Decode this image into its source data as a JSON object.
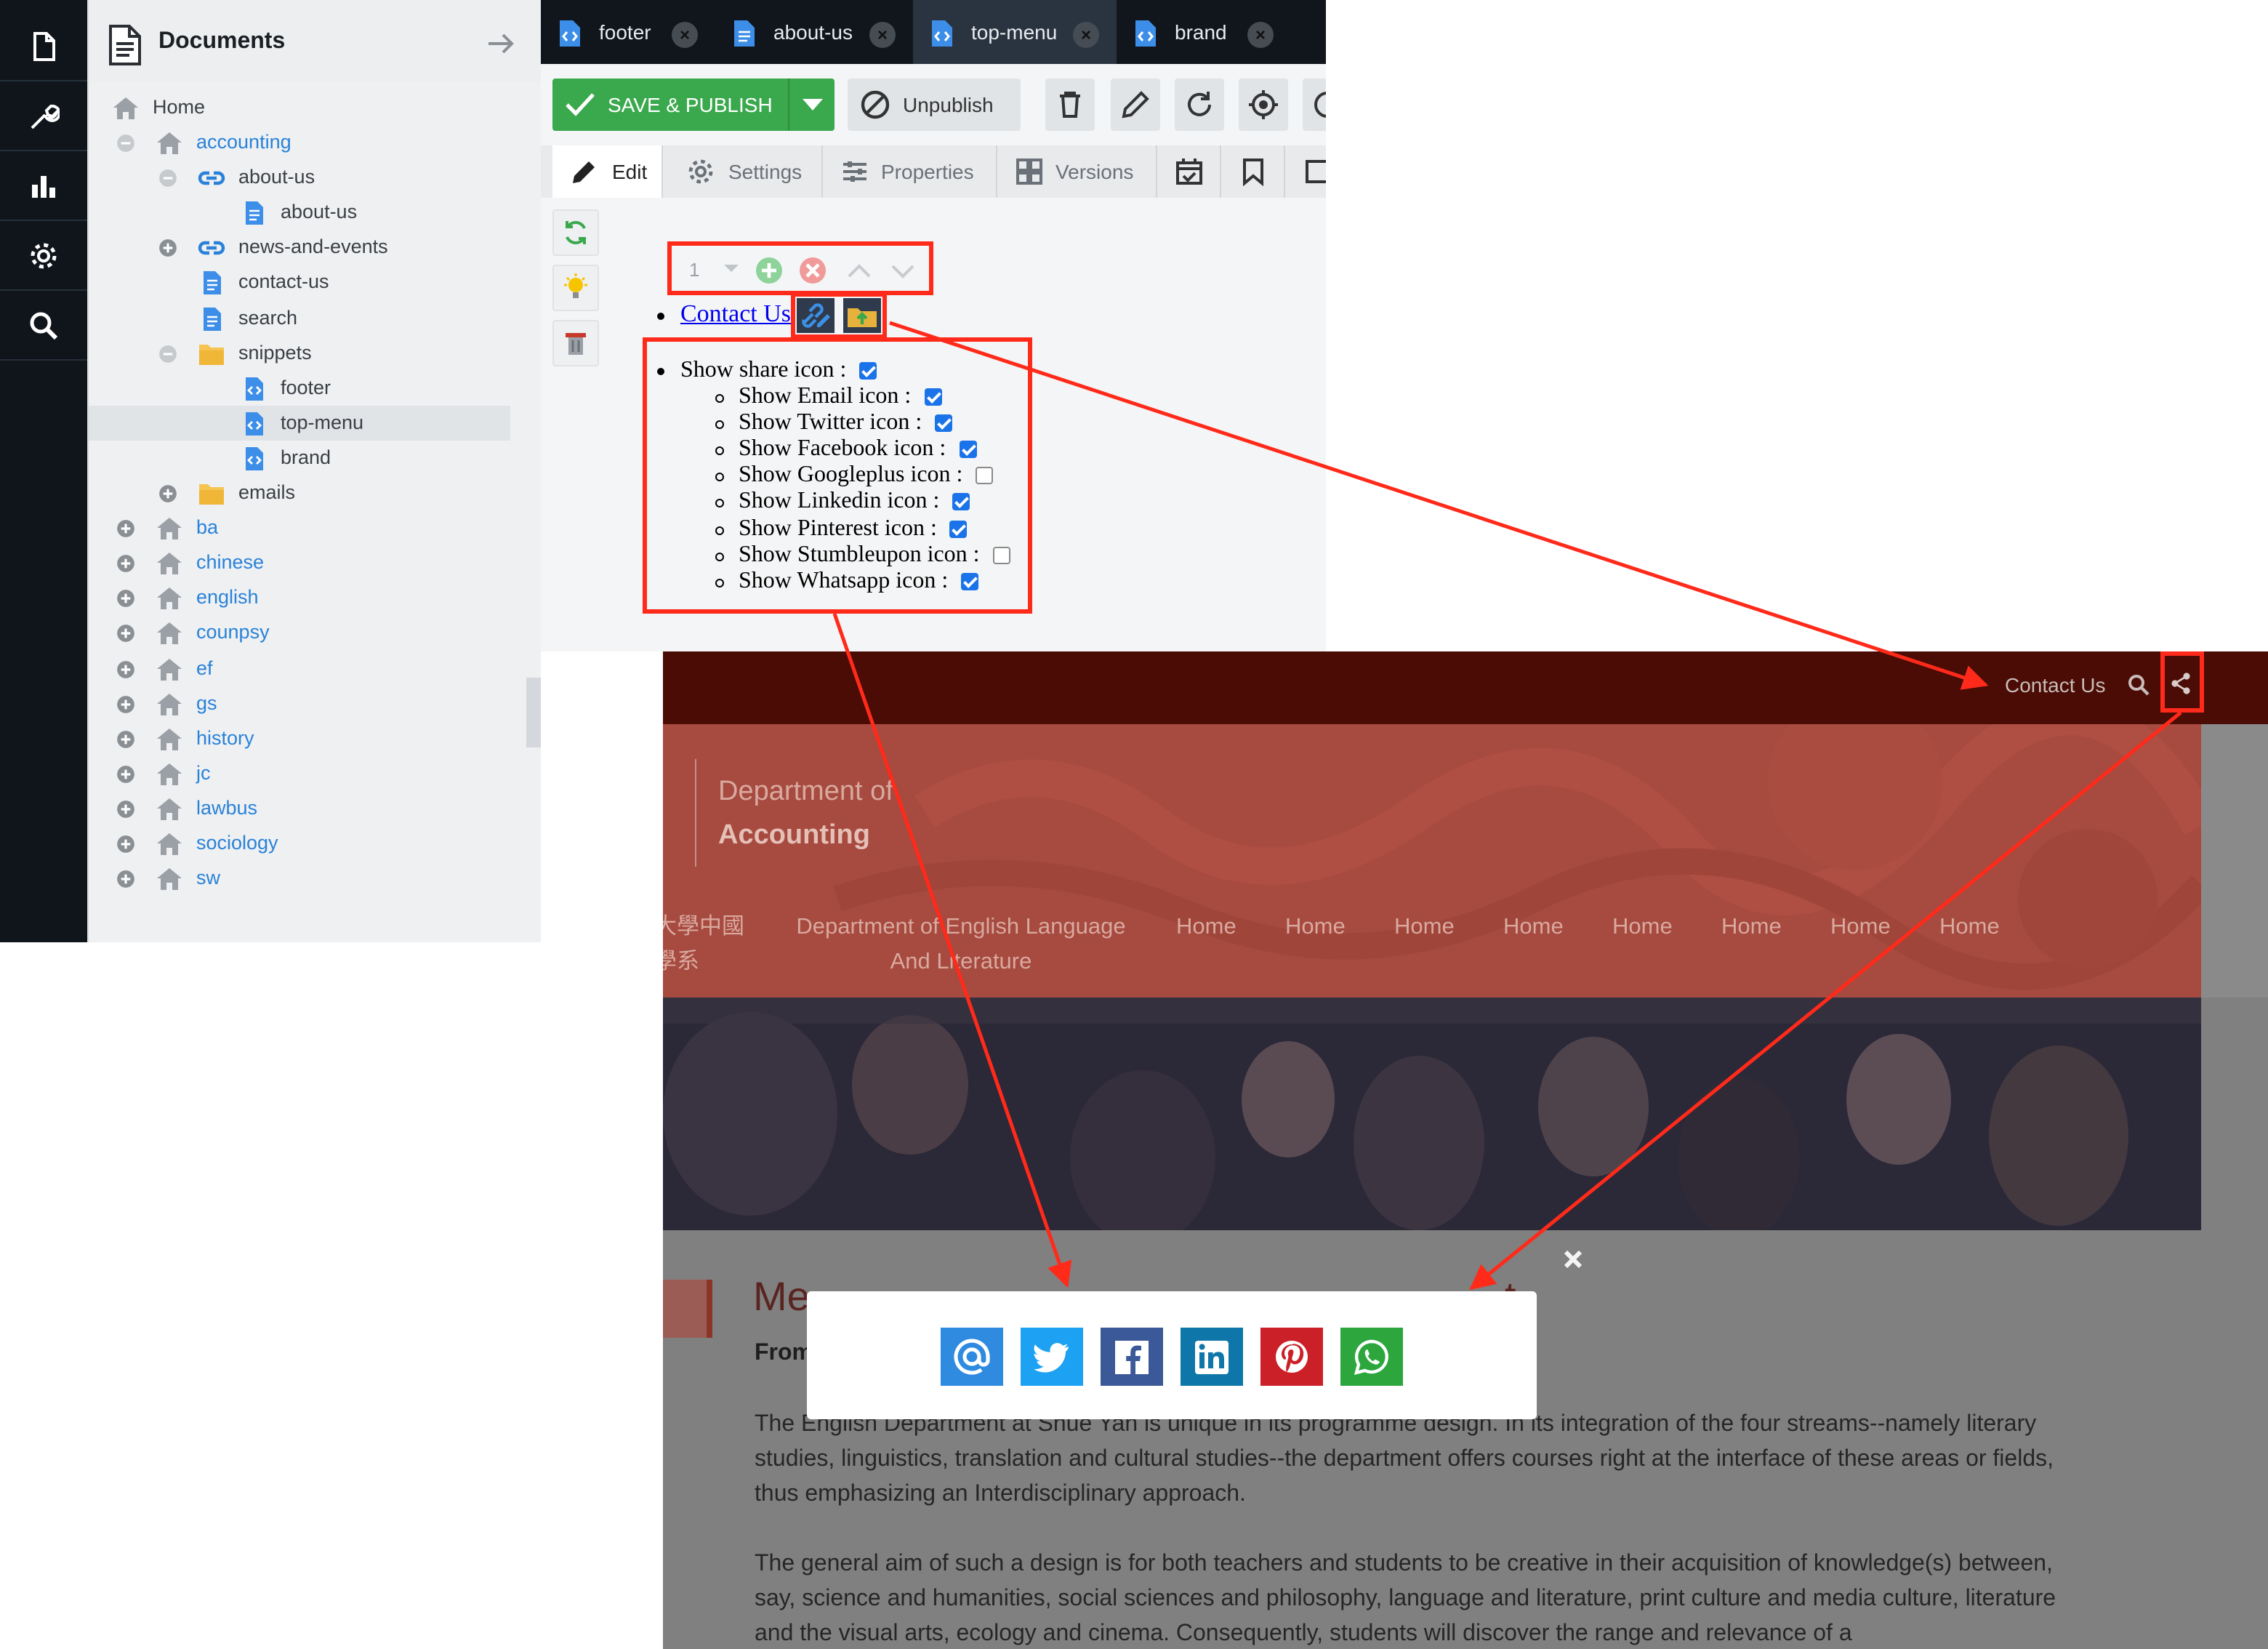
{
  "cms": {
    "documents_panel": {
      "title": "Documents",
      "tree": [
        {
          "label": "Home",
          "depth": 0,
          "toggle": "none",
          "icon": "home-icon",
          "linked": false
        },
        {
          "label": "accounting",
          "depth": 0,
          "toggle": "minus",
          "icon": "home-icon",
          "linked": true
        },
        {
          "label": "about-us",
          "depth": 1,
          "toggle": "minus",
          "icon": "link-icon",
          "linked": false
        },
        {
          "label": "about-us",
          "depth": 2,
          "toggle": "none",
          "icon": "page-icon",
          "linked": false
        },
        {
          "label": "news-and-events",
          "depth": 1,
          "toggle": "plus",
          "icon": "link-icon",
          "linked": false
        },
        {
          "label": "contact-us",
          "depth": 1,
          "toggle": "none",
          "icon": "page-icon",
          "linked": false
        },
        {
          "label": "search",
          "depth": 1,
          "toggle": "none",
          "icon": "page-icon",
          "linked": false
        },
        {
          "label": "snippets",
          "depth": 1,
          "toggle": "minus",
          "icon": "folder-icon",
          "linked": false
        },
        {
          "label": "footer",
          "depth": 2,
          "toggle": "none",
          "icon": "snippet-icon",
          "linked": false
        },
        {
          "label": "top-menu",
          "depth": 2,
          "toggle": "none",
          "icon": "snippet-icon",
          "linked": false,
          "selected": true
        },
        {
          "label": "brand",
          "depth": 2,
          "toggle": "none",
          "icon": "snippet-icon",
          "linked": false
        },
        {
          "label": "emails",
          "depth": 1,
          "toggle": "plus",
          "icon": "folder-icon",
          "linked": false
        },
        {
          "label": "ba",
          "depth": 0,
          "toggle": "plus",
          "icon": "home-icon",
          "linked": true
        },
        {
          "label": "chinese",
          "depth": 0,
          "toggle": "plus",
          "icon": "home-icon",
          "linked": true
        },
        {
          "label": "english",
          "depth": 0,
          "toggle": "plus",
          "icon": "home-icon",
          "linked": true
        },
        {
          "label": "counpsy",
          "depth": 0,
          "toggle": "plus",
          "icon": "home-icon",
          "linked": true
        },
        {
          "label": "ef",
          "depth": 0,
          "toggle": "plus",
          "icon": "home-icon",
          "linked": true
        },
        {
          "label": "gs",
          "depth": 0,
          "toggle": "plus",
          "icon": "home-icon",
          "linked": true
        },
        {
          "label": "history",
          "depth": 0,
          "toggle": "plus",
          "icon": "home-icon",
          "linked": true
        },
        {
          "label": "jc",
          "depth": 0,
          "toggle": "plus",
          "icon": "home-icon",
          "linked": true
        },
        {
          "label": "lawbus",
          "depth": 0,
          "toggle": "plus",
          "icon": "home-icon",
          "linked": true
        },
        {
          "label": "sociology",
          "depth": 0,
          "toggle": "plus",
          "icon": "home-icon",
          "linked": true
        },
        {
          "label": "sw",
          "depth": 0,
          "toggle": "plus",
          "icon": "home-icon",
          "linked": true
        }
      ]
    },
    "tabs": [
      {
        "label": "footer",
        "active": false
      },
      {
        "label": "about-us",
        "active": false
      },
      {
        "label": "top-menu",
        "active": true
      },
      {
        "label": "brand",
        "active": false
      }
    ],
    "toolbar": {
      "save_label": "SAVE & PUBLISH",
      "unpublish_label": "Unpublish"
    },
    "subtabs": {
      "edit": "Edit",
      "settings": "Settings",
      "properties": "Properties",
      "versions": "Versions"
    },
    "editable": {
      "block_number": "1",
      "link_text": "Contact Us",
      "share_options": [
        {
          "label": "Show share icon :",
          "checked": true,
          "level": 0
        },
        {
          "label": "Show Email icon :",
          "checked": true,
          "level": 1
        },
        {
          "label": "Show Twitter icon :",
          "checked": true,
          "level": 1
        },
        {
          "label": "Show Facebook icon :",
          "checked": true,
          "level": 1
        },
        {
          "label": "Show Googleplus icon :",
          "checked": false,
          "level": 1
        },
        {
          "label": "Show Linkedin icon :",
          "checked": true,
          "level": 1
        },
        {
          "label": "Show Pinterest icon :",
          "checked": true,
          "level": 1
        },
        {
          "label": "Show Stumbleupon icon :",
          "checked": false,
          "level": 1
        },
        {
          "label": "Show Whatsapp icon :",
          "checked": true,
          "level": 1
        }
      ]
    }
  },
  "site": {
    "topbar": {
      "contact_label": "Contact Us"
    },
    "header": {
      "dept_line1": "Department of",
      "dept_line2": "Accounting"
    },
    "nav": {
      "cut_item_line1": "大學中國",
      "cut_item_line2": "學系",
      "english_item": "Department of English Language And Literature",
      "home_items": [
        "Home",
        "Home",
        "Home",
        "Home",
        "Home",
        "Home",
        "Home",
        "Home"
      ]
    },
    "content": {
      "heading_visible_start": "Me",
      "heading_visible_end": "t",
      "from_label": "From",
      "paragraph_1": "The English Department at Shue Yan is unique in its programme design.  In its integration of the four streams--namely literary studies, linguistics, translation and cultural studies--the department offers courses right at the interface of these areas or fields, thus emphasizing an Interdisciplinary approach.",
      "paragraph_2": "The general aim of such a design is for both teachers and students to be creative in their acquisition of knowledge(s) between, say, science and humanities, social sciences and philosophy, language and literature, print culture and media culture, literature and the visual arts, ecology and cinema. Consequently, students will discover the range and relevance of a"
    },
    "share_popup": {
      "buttons": [
        {
          "name": "email",
          "icon": "at-icon",
          "color": "#2f8be0"
        },
        {
          "name": "twitter",
          "icon": "twitter-icon",
          "color": "#1da1f2"
        },
        {
          "name": "facebook",
          "icon": "facebook-icon",
          "color": "#3b5998"
        },
        {
          "name": "linkedin",
          "icon": "linkedin-icon",
          "color": "#0e76a8"
        },
        {
          "name": "pinterest",
          "icon": "pinterest-icon",
          "color": "#cb2027"
        },
        {
          "name": "whatsapp",
          "icon": "whatsapp-icon",
          "color": "#2ca63d"
        }
      ]
    }
  },
  "colors": {
    "annotation": "#ff2a1a",
    "save_green": "#3aa84d",
    "link_blue": "#2a82d8",
    "site_maroon": "#4a0c05"
  }
}
